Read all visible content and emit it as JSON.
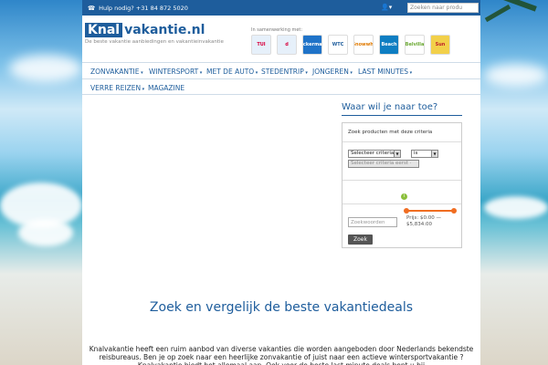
{
  "topbar": {
    "phone_icon": "phone-icon",
    "phone_text": "Hulp nodig? +31 84 872 5020",
    "user_icon": "user-icon",
    "search_placeholder": "Zoeken naar produ"
  },
  "header": {
    "logo_knal": "Knal",
    "logo_rest": "vakantie.nl",
    "tagline": "De beste vakantie aanbiedingen en vakantieinvakantie",
    "partners_label": "In samenwerking met:",
    "partners": [
      {
        "name": "TUI",
        "color": "#e6f0fa",
        "text_color": "#d8003c"
      },
      {
        "name": "d",
        "color": "#e6f0fa",
        "text_color": "#d8003c"
      },
      {
        "name": "Neckermann",
        "color": "#1f73c8",
        "text_color": "#ffffff"
      },
      {
        "name": "WTC",
        "color": "#ffffff",
        "text_color": "#1e5d9c"
      },
      {
        "name": "Snowwhi",
        "color": "#ffffff",
        "text_color": "#e07a00"
      },
      {
        "name": "Beach",
        "color": "#0e7ec2",
        "text_color": "#ffffff"
      },
      {
        "name": "Belvilla",
        "color": "#ffffff",
        "text_color": "#6aa832"
      },
      {
        "name": "Sun",
        "color": "#f2d04a",
        "text_color": "#c0202a"
      }
    ]
  },
  "nav": {
    "items": [
      {
        "label": "ZONVAKANTIE",
        "has_caret": true
      },
      {
        "label": "WINTERSPORT",
        "has_caret": true
      },
      {
        "label": "MET DE AUTO",
        "has_caret": true
      },
      {
        "label": "STEDENTRIP",
        "has_caret": true
      },
      {
        "label": "JONGEREN",
        "has_caret": true
      },
      {
        "label": "LAST MINUTES",
        "has_caret": true
      },
      {
        "label": "VERRE REIZEN",
        "has_caret": true
      },
      {
        "label": "MAGAZINE",
        "has_caret": false
      }
    ],
    "caret_glyph": "▾"
  },
  "sidebar": {
    "title": "Waar wil je naar toe?",
    "filter_label": "Zoek producten met deze criteria",
    "criteria_select": "Selecteer criteria",
    "operator_select": "is",
    "value_select": "Selecteer criteria eerst ·",
    "info_icon": "i",
    "keywords_placeholder": "Zoekwoorden",
    "price_label": "Prijs: $0.00 — $5,834.00",
    "price_min": 0,
    "price_max": 5834,
    "search_button": "Zoek",
    "accent_color": "#f06d21"
  },
  "main": {
    "heading": "Zoek en vergelijk de beste vakantiedeals",
    "text": "Knalvakantie heeft een ruim aanbod van diverse vakanties die worden aangeboden door Nederlands bekendste reisbureaus. Ben je op zoek naar een heerlijke zonvakantie of juist naar een actieve wintersportvakantie ? Knalvakantie biedt het allemaal aan. Ook voor de beste last minute deals bent u bij"
  },
  "colors": {
    "brand": "#1e5d9c",
    "topbar": "#1e5d9c"
  }
}
